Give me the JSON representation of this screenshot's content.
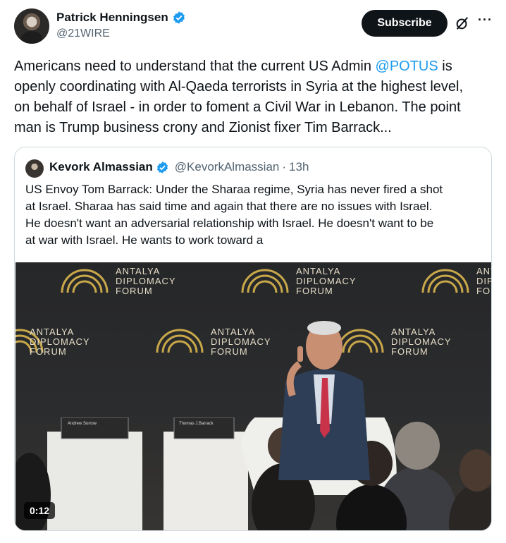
{
  "author": {
    "name": "Patrick Henningsen",
    "handle": "@21WIRE"
  },
  "actions": {
    "subscribe_label": "Subscribe"
  },
  "tweet": {
    "line1_pre": "Americans need to understand that the current US Admin ",
    "mention": "@POTUS",
    "line1_post": " is",
    "line2": "openly coordinating with Al-Qaeda terrorists in Syria at the highest level,",
    "line3": "on behalf of Israel - in order to foment a Civil War in Lebanon. The point",
    "line4": "man is Trump business crony and Zionist fixer Tim Barrack..."
  },
  "quote": {
    "name": "Kevork Almassian",
    "handle": "@KevorkAlmassian",
    "separator": "·",
    "time": "13h",
    "lines": [
      "US Envoy Tom Barrack: Under the Sharaa regime, Syria has never fired a shot",
      "at Israel. Sharaa has said time and again that there are no issues with Israel.",
      "He doesn't want an adversarial relationship with Israel. He doesn't want to be",
      "at war with Israel. He wants to work toward a"
    ]
  },
  "video": {
    "duration": "0:12",
    "backdrop_lines": [
      "ANTALYA",
      "DIPLOMACY",
      "FORUM"
    ],
    "nameplate_left": "Andrew Sorrow",
    "nameplate_right": "Thomas J.Barrack"
  },
  "colors": {
    "verified": "#1d9bf0",
    "mention": "#1d9bf0",
    "subscribe_bg": "#0f1419",
    "backdrop_gold": "#c9a84a"
  }
}
